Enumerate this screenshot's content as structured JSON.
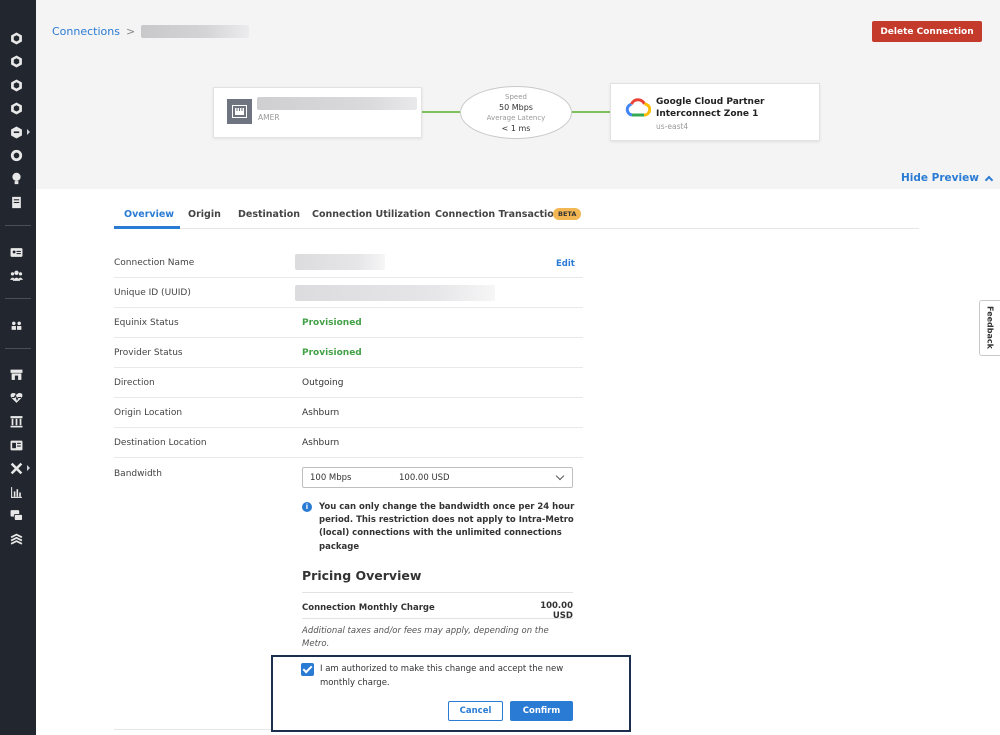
{
  "sidebar": {
    "icons": [
      "cube-icon",
      "cube-icon",
      "cube-icon",
      "cube-icon",
      "cube-menu-icon",
      "compass-icon",
      "lightbulb-icon",
      "document-icon",
      "id-card-icon",
      "users-icon",
      "team-icon",
      "storefront-icon",
      "heart-pulse-icon",
      "building-icon",
      "list-card-icon",
      "tools-icon",
      "bar-chart-icon",
      "chat-icon",
      "layers-icon"
    ]
  },
  "breadcrumb": {
    "link": "Connections",
    "separator": ">"
  },
  "header": {
    "delete_label": "Delete Connection"
  },
  "preview": {
    "origin": {
      "region": "AMER"
    },
    "speed_label": "Speed",
    "speed_value": "50 Mbps",
    "latency_label": "Average Latency",
    "latency_value": "< 1 ms",
    "destination": {
      "name_line1": "Google Cloud Partner",
      "name_line2": "Interconnect Zone 1",
      "region": "us-east4"
    },
    "hide_label": "Hide Preview"
  },
  "tabs": [
    {
      "label": "Overview",
      "active": true
    },
    {
      "label": "Origin",
      "active": false
    },
    {
      "label": "Destination",
      "active": false
    },
    {
      "label": "Connection Utilization",
      "active": false
    },
    {
      "label": "Connection Transactions",
      "active": false,
      "badge": "BETA"
    }
  ],
  "details": {
    "connection_name": {
      "label": "Connection Name",
      "edit": "Edit"
    },
    "uuid": {
      "label": "Unique ID (UUID)"
    },
    "equinix_status": {
      "label": "Equinix Status",
      "value": "Provisioned"
    },
    "provider_status": {
      "label": "Provider Status",
      "value": "Provisioned"
    },
    "direction": {
      "label": "Direction",
      "value": "Outgoing"
    },
    "origin_location": {
      "label": "Origin Location",
      "value": "Ashburn"
    },
    "destination_location": {
      "label": "Destination Location",
      "value": "Ashburn"
    },
    "bandwidth": {
      "label": "Bandwidth",
      "speed": "100 Mbps",
      "price": "100.00 USD"
    }
  },
  "info_text": "You can only change the bandwidth once per 24 hour period. This restriction does not apply to Intra-Metro (local) connections with the unlimited connections package",
  "pricing": {
    "title": "Pricing Overview",
    "charge_label": "Connection Monthly Charge",
    "charge_value": "100.00 USD",
    "disclaimer": "Additional taxes and/or fees may apply, depending on the Metro."
  },
  "confirm": {
    "checkbox_checked": true,
    "authorization_text": "I am authorized to make this change and accept the new monthly charge.",
    "cancel_label": "Cancel",
    "confirm_label": "Confirm"
  },
  "feedback_label": "Feedback",
  "colors": {
    "accent": "#2a7bd3",
    "danger": "#c43a2b",
    "success": "#43a047",
    "sidebar": "#22262e",
    "link_line": "#7cc15b"
  }
}
